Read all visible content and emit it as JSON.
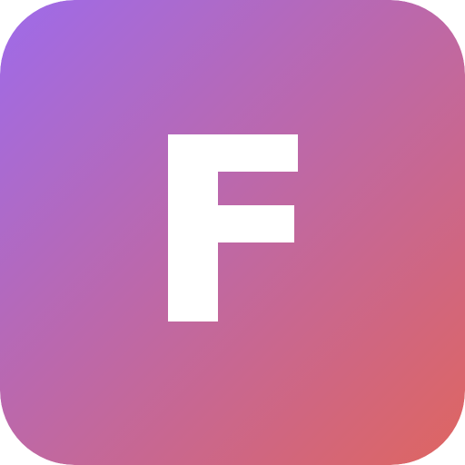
{
  "icon": {
    "letter": "F",
    "letter_color": "#ffffff",
    "gradient_start": "#9e6bea",
    "gradient_end": "#df6560"
  }
}
